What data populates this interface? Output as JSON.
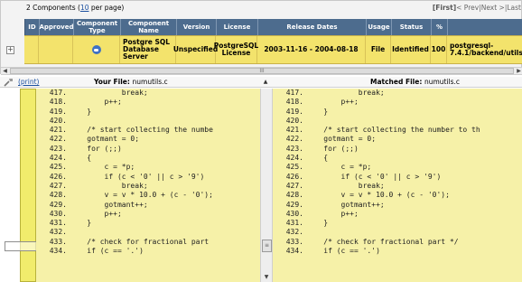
{
  "components": {
    "count_text": "2 Components (",
    "per_page_link": "10",
    "per_page_suffix": " per page)",
    "pager": {
      "first": "[First]",
      "prev": "< Prev",
      "sep": "|",
      "next": "Next >",
      "last": "|Last"
    },
    "columns": [
      "ID",
      "Approved",
      "Component Type",
      "Component Name",
      "Version",
      "License",
      "Release Dates",
      "Usage",
      "Status",
      "%",
      ""
    ],
    "row": {
      "id": "",
      "approved": "",
      "type_icon": "component-type-icon",
      "name": "Postgre SQL Database Server",
      "version": "Unspecified",
      "license": "PostgreSQL License",
      "release_dates": "2003-11-16 - 2004-08-18",
      "usage": "File",
      "status": "Identified",
      "percent": "100",
      "path": "postgresql-7.4.1/backend/utils/"
    },
    "hscroll_grip": "III"
  },
  "diff": {
    "print_label": "(print)",
    "your_file_label": "Your File:",
    "your_file_name": "numutils.c",
    "matched_file_label": "Matched File:",
    "matched_file_name": "numutils.c",
    "left_lines": [
      {
        "n": "417.",
        "t": "            break;"
      },
      {
        "n": "418.",
        "t": "        p++;"
      },
      {
        "n": "419.",
        "t": "    }"
      },
      {
        "n": "420.",
        "t": ""
      },
      {
        "n": "421.",
        "t": "    /* start collecting the numbe"
      },
      {
        "n": "422.",
        "t": "    gotmant = 0;"
      },
      {
        "n": "423.",
        "t": "    for (;;)"
      },
      {
        "n": "424.",
        "t": "    {"
      },
      {
        "n": "425.",
        "t": "        c = *p;"
      },
      {
        "n": "426.",
        "t": "        if (c < '0' || c > '9')"
      },
      {
        "n": "427.",
        "t": "            break;"
      },
      {
        "n": "428.",
        "t": "        v = v * 10.0 + (c - '0');"
      },
      {
        "n": "429.",
        "t": "        gotmant++;"
      },
      {
        "n": "430.",
        "t": "        p++;"
      },
      {
        "n": "431.",
        "t": "    }"
      },
      {
        "n": "432.",
        "t": ""
      },
      {
        "n": "433.",
        "t": "    /* check for fractional part"
      },
      {
        "n": "434.",
        "t": "    if (c == '.')"
      }
    ],
    "right_lines": [
      {
        "n": "417.",
        "t": "            break;"
      },
      {
        "n": "418.",
        "t": "        p++;"
      },
      {
        "n": "419.",
        "t": "    }"
      },
      {
        "n": "420.",
        "t": ""
      },
      {
        "n": "421.",
        "t": "    /* start collecting the number to th"
      },
      {
        "n": "422.",
        "t": "    gotmant = 0;"
      },
      {
        "n": "423.",
        "t": "    for (;;)"
      },
      {
        "n": "424.",
        "t": "    {"
      },
      {
        "n": "425.",
        "t": "        c = *p;"
      },
      {
        "n": "426.",
        "t": "        if (c < '0' || c > '9')"
      },
      {
        "n": "427.",
        "t": "            break;"
      },
      {
        "n": "428.",
        "t": "        v = v * 10.0 + (c - '0');"
      },
      {
        "n": "429.",
        "t": "        gotmant++;"
      },
      {
        "n": "430.",
        "t": "        p++;"
      },
      {
        "n": "431.",
        "t": "    }"
      },
      {
        "n": "432.",
        "t": ""
      },
      {
        "n": "433.",
        "t": "    /* check for fractional part */"
      },
      {
        "n": "434.",
        "t": "    if (c == '.')"
      }
    ]
  },
  "colors": {
    "header_bg": "#4d6c8e",
    "match_bg": "#f6f1a8",
    "row_highlight": "#f3e36c",
    "link": "#1a4fa0"
  }
}
